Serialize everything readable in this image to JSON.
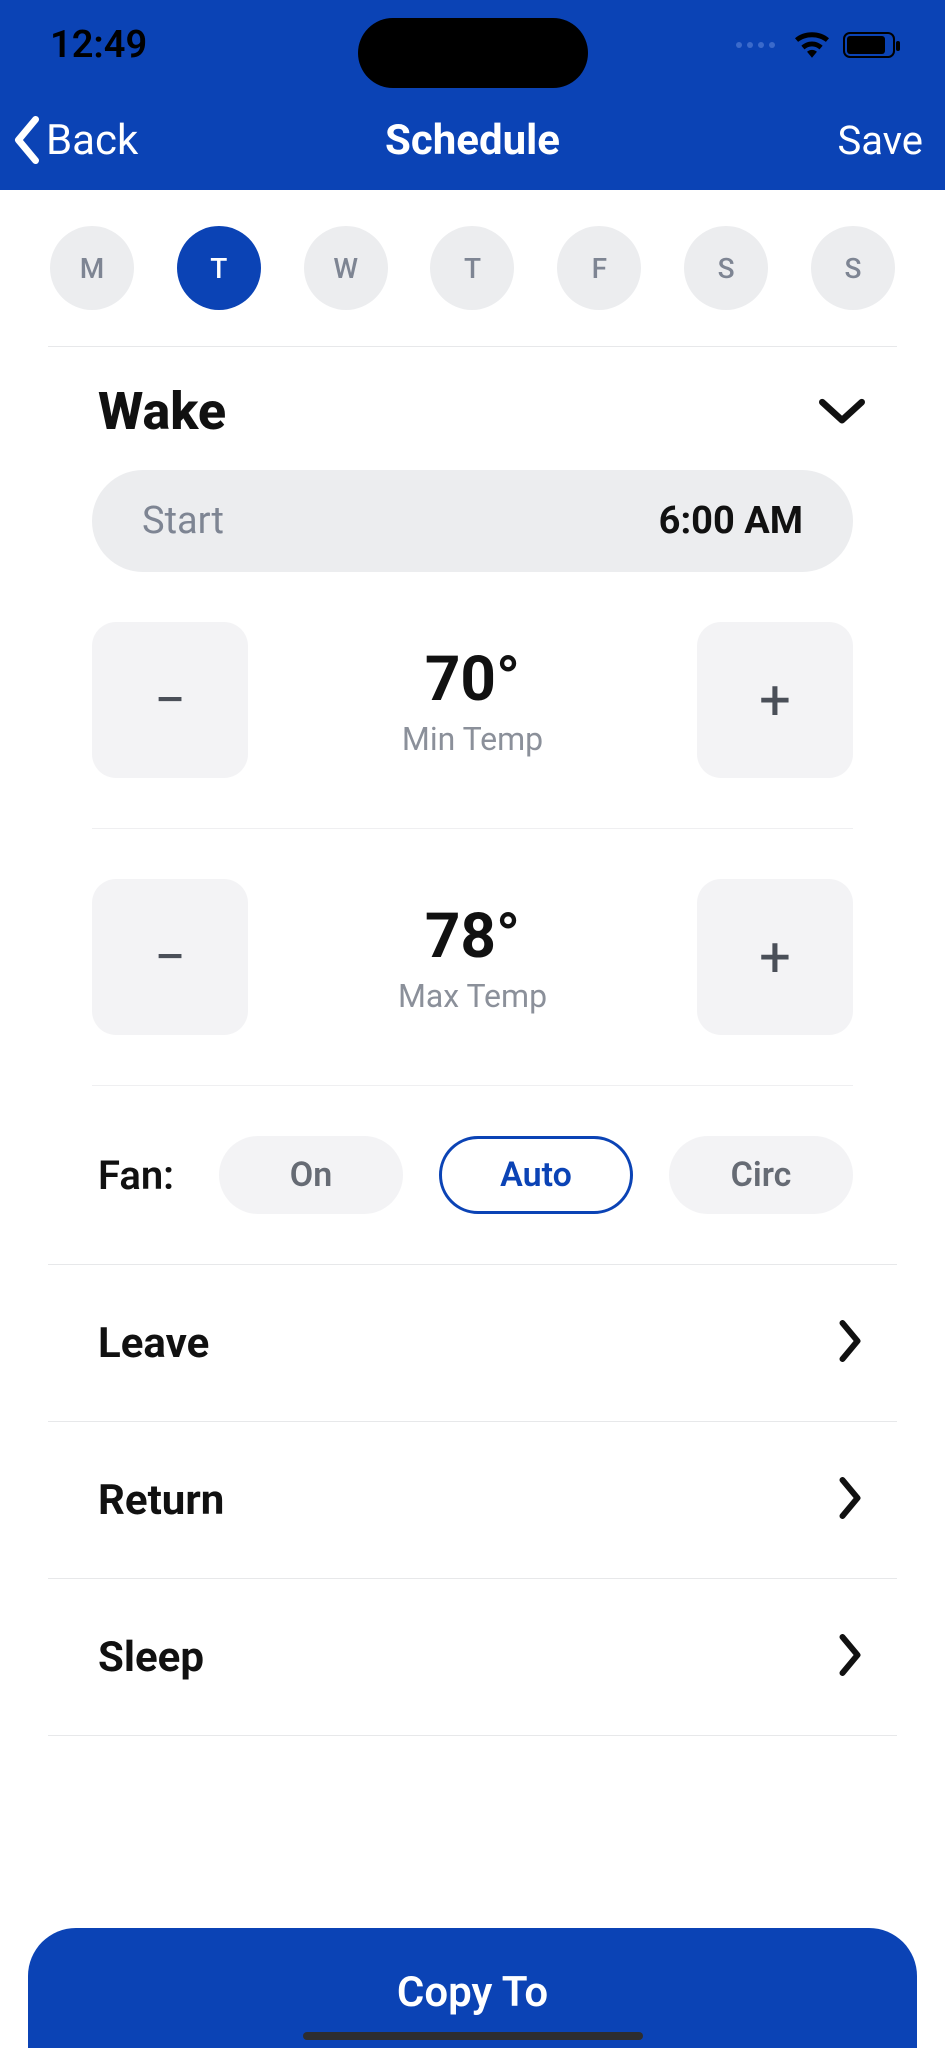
{
  "status": {
    "time": "12:49"
  },
  "nav": {
    "back": "Back",
    "title": "Schedule",
    "save": "Save"
  },
  "days": [
    {
      "label": "M",
      "selected": false
    },
    {
      "label": "T",
      "selected": true
    },
    {
      "label": "W",
      "selected": false
    },
    {
      "label": "T",
      "selected": false
    },
    {
      "label": "F",
      "selected": false
    },
    {
      "label": "S",
      "selected": false
    },
    {
      "label": "S",
      "selected": false
    }
  ],
  "wake": {
    "title": "Wake",
    "start_label": "Start",
    "start_value": "6:00 AM",
    "min_temp": "70°",
    "min_label": "Min Temp",
    "max_temp": "78°",
    "max_label": "Max Temp"
  },
  "fan": {
    "label": "Fan:",
    "options": {
      "on": "On",
      "auto": "Auto",
      "circ": "Circ"
    },
    "selected": "Auto"
  },
  "sections": {
    "leave": "Leave",
    "return": "Return",
    "sleep": "Sleep"
  },
  "copy_to": "Copy To",
  "glyphs": {
    "minus": "−",
    "plus": "+"
  }
}
